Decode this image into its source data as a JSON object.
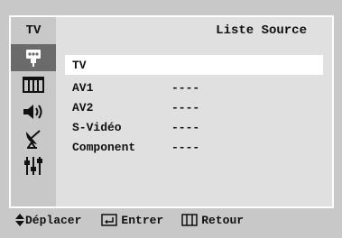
{
  "header": {
    "tab": "TV",
    "title": "Liste Source"
  },
  "sidebar": {
    "items": [
      {
        "icon": "input-icon",
        "active": true
      },
      {
        "icon": "picture-icon",
        "active": false
      },
      {
        "icon": "sound-icon",
        "active": false
      },
      {
        "icon": "channel-antenna-icon",
        "active": false
      },
      {
        "icon": "setup-sliders-icon",
        "active": false
      }
    ]
  },
  "sources": [
    {
      "name": "TV",
      "value": "",
      "selected": true
    },
    {
      "name": "AV1",
      "value": "----",
      "selected": false
    },
    {
      "name": "AV2",
      "value": "----",
      "selected": false
    },
    {
      "name": "S-Vidéo",
      "value": "----",
      "selected": false
    },
    {
      "name": "Component",
      "value": "----",
      "selected": false
    }
  ],
  "footer": {
    "move_label": "Déplacer",
    "enter_label": "Entrer",
    "return_label": "Retour"
  },
  "colors": {
    "background": "#c8c8c8",
    "panel": "#e0e0e0",
    "selected_row": "#ffffff",
    "active_sidebar": "#6b6b6b"
  }
}
